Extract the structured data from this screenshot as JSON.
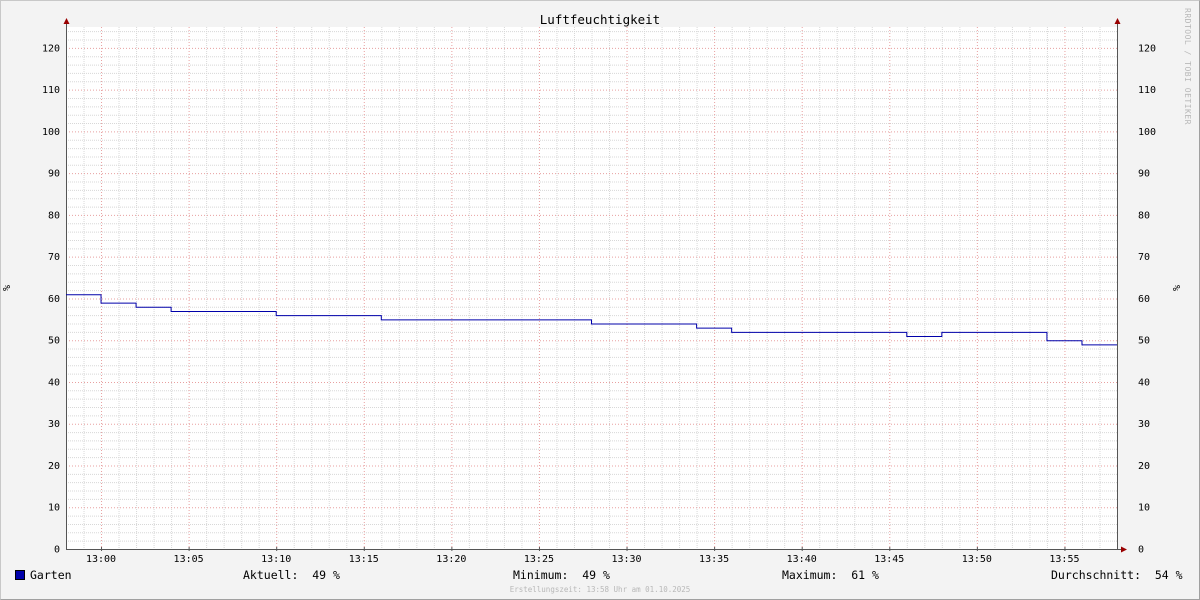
{
  "chart_data": {
    "type": "line",
    "title": "Luftfeuchtigkeit",
    "ylabel": "%",
    "ylabel_right": "%",
    "ylim": [
      0,
      125
    ],
    "y_ticks": [
      0,
      10,
      20,
      30,
      40,
      50,
      60,
      70,
      80,
      90,
      100,
      110,
      120
    ],
    "x_tick_labels": [
      "13:00",
      "13:05",
      "13:10",
      "13:15",
      "13:20",
      "13:25",
      "13:30",
      "13:35",
      "13:40",
      "13:45",
      "13:50",
      "13:55"
    ],
    "xlim": [
      "12:58",
      "13:58"
    ],
    "grid": true,
    "step": true,
    "series": [
      {
        "name": "Garten",
        "color": "#0000aa",
        "x": [
          "12:58",
          "13:00",
          "13:02",
          "13:04",
          "13:10",
          "13:16",
          "13:28",
          "13:34",
          "13:36",
          "13:46",
          "13:48",
          "13:54",
          "13:56",
          "13:58"
        ],
        "values": [
          61,
          59,
          58,
          57,
          56,
          55,
          54,
          53,
          52,
          51,
          52,
          50,
          49,
          49
        ]
      }
    ]
  },
  "legend": {
    "series_name": "Garten",
    "current_label": "Aktuell:",
    "current_value": "49 %",
    "min_label": "Minimum:",
    "min_value": "49 %",
    "max_label": "Maximum:",
    "max_value": "61 %",
    "avg_label": "Durchschnitt:",
    "avg_value": "54 %"
  },
  "footer": "Erstellungszeit: 13:58 Uhr am 01.10.2025",
  "watermark": "RRDTOOL / TOBI OETIKER",
  "colors": {
    "background": "#f3f3f3",
    "plot_background": "#ffffff",
    "major_grid": "#e8a0a0",
    "minor_grid": "#d8d8d8",
    "axis": "#555555",
    "arrow": "#990000"
  }
}
